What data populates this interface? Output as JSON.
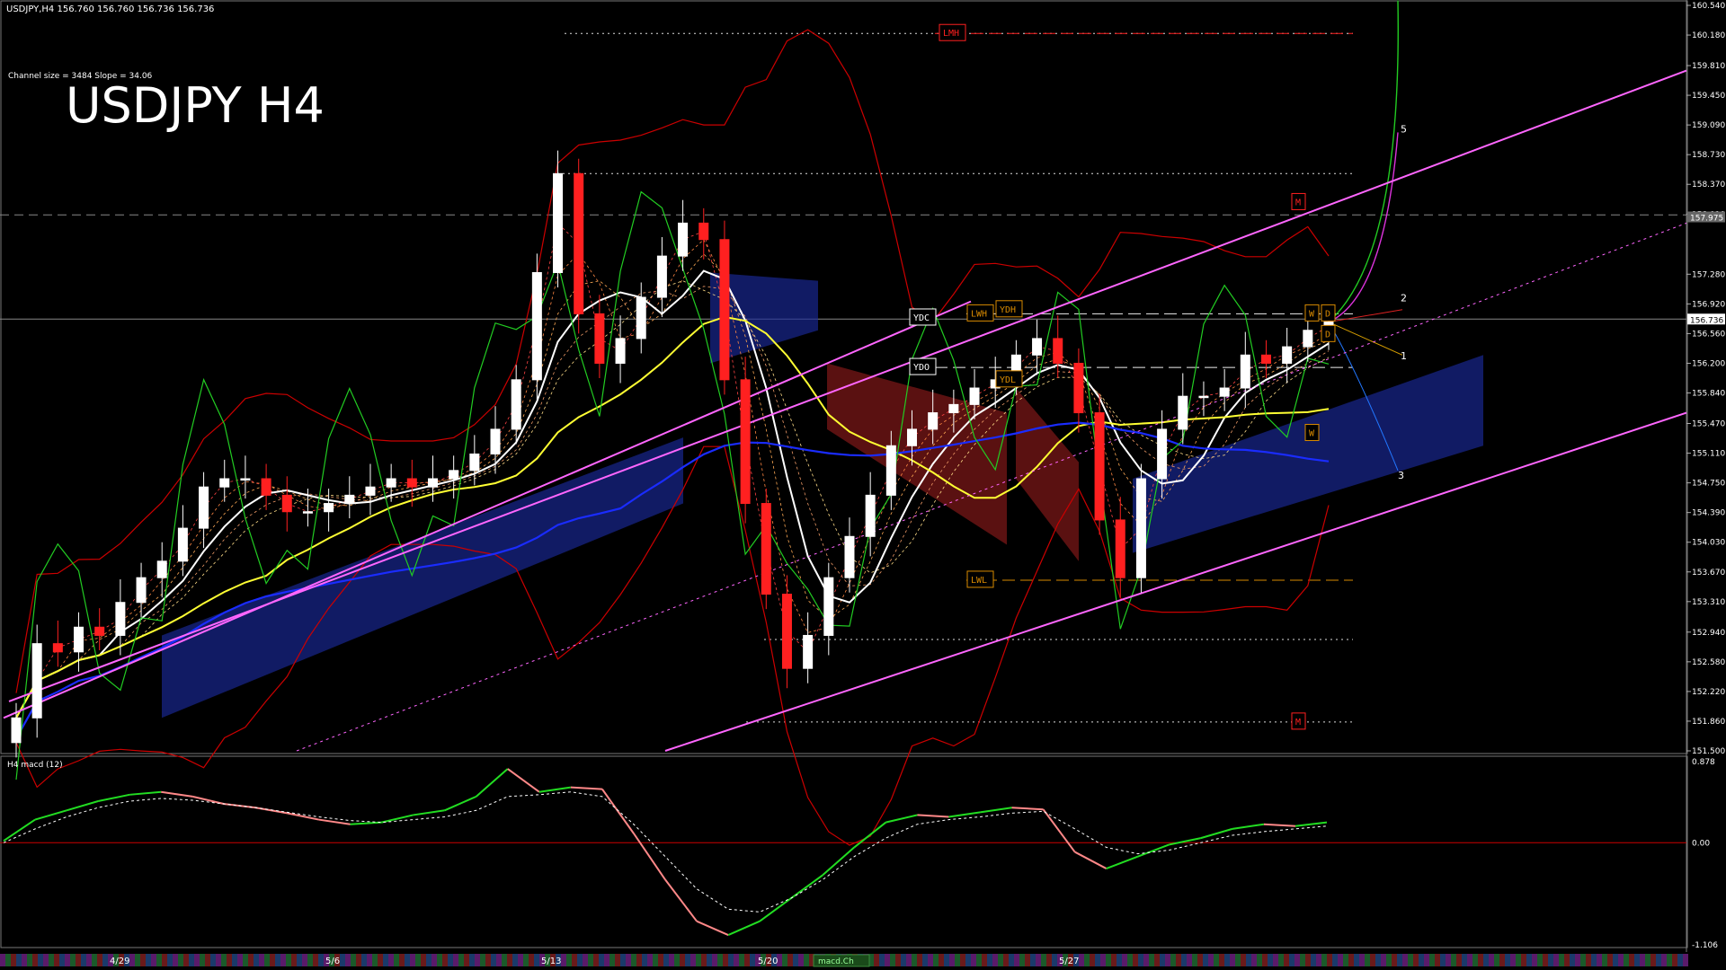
{
  "header": {
    "symbol_info": "USDJPY,H4  156.760 156.760 156.736 156.736",
    "channel_info": "Channel size = 3484 Slope = 34.06",
    "big_title": "USDJPY H4"
  },
  "colors": {
    "background": "#000000",
    "bull_candle": "#ffffff",
    "bear_candle": "#ff2020",
    "channel": "#ff66ff",
    "ma_white": "#ffffff",
    "ma_yellow": "#ffff33",
    "ma_blue": "#1a2cff",
    "bollinger": "#cc0000",
    "rsi_green": "#22cc22",
    "ichimoku_cloud": "#1a2a9a",
    "ichimoku_cloud_bear": "#8a1a1a",
    "label_orange": "#d98a00",
    "macd_main_up": "#22dd22",
    "macd_main_down": "#ff8888",
    "macd_signal": "#ffffff"
  },
  "chart_data": {
    "type": "candlestick",
    "symbol": "USDJPY",
    "timeframe": "H4",
    "price_axis": {
      "ylim": [
        151.5,
        160.54
      ],
      "ticks": [
        "160.540",
        "160.180",
        "159.810",
        "159.450",
        "159.090",
        "158.730",
        "158.370",
        "158.010",
        "157.280",
        "156.920",
        "156.560",
        "156.200",
        "155.840",
        "155.470",
        "155.110",
        "154.750",
        "154.390",
        "154.030",
        "153.670",
        "153.310",
        "152.940",
        "152.580",
        "152.220",
        "151.860",
        "151.500"
      ],
      "current_price": "156.736",
      "marked_price": "157.975"
    },
    "date_ticks": [
      "4/29",
      "5/6",
      "5/13",
      "5/20",
      "5/27"
    ],
    "levels": [
      {
        "label": "LMH",
        "price": 160.2
      },
      {
        "label": "M",
        "price": 158.15
      },
      {
        "label": "M",
        "price": 151.85
      },
      {
        "label": "YDC",
        "price": 156.75
      },
      {
        "label": "YDO",
        "price": 156.15
      },
      {
        "label": "YDH",
        "price": 156.85
      },
      {
        "label": "YDL",
        "price": 156.0
      },
      {
        "label": "LWH",
        "price": 156.8
      },
      {
        "label": "LWL",
        "price": 153.57
      },
      {
        "label": "W",
        "price": 156.8
      },
      {
        "label": "W",
        "price": 155.35
      },
      {
        "label": "D",
        "price": 156.8
      },
      {
        "label": "D",
        "price": 156.55
      }
    ],
    "projection_labels": [
      "5",
      "2",
      "1",
      "3"
    ],
    "candles_close": [
      151.9,
      152.8,
      152.7,
      153.0,
      152.9,
      153.3,
      153.6,
      153.8,
      154.2,
      154.7,
      154.8,
      154.8,
      154.6,
      154.4,
      154.4,
      154.5,
      154.6,
      154.7,
      154.8,
      154.7,
      154.8,
      154.9,
      155.1,
      155.4,
      156.0,
      157.3,
      158.5,
      156.8,
      156.2,
      156.5,
      157.0,
      157.5,
      157.9,
      157.7,
      156.0,
      154.5,
      153.4,
      152.5,
      152.9,
      153.6,
      154.1,
      154.6,
      155.2,
      155.4,
      155.6,
      155.7,
      155.9,
      156.0,
      156.3,
      156.5,
      156.2,
      155.6,
      154.3,
      153.6,
      154.8,
      155.4,
      155.8,
      155.8,
      155.9,
      156.3,
      156.2,
      156.4,
      156.6,
      156.7
    ],
    "macd": {
      "title": "H4 macd (12)",
      "ylim": [
        -1.106,
        0.878
      ],
      "ticks": [
        "0.878",
        "0.00",
        "-1.106"
      ],
      "main": [
        0.02,
        0.25,
        0.35,
        0.45,
        0.52,
        0.55,
        0.5,
        0.42,
        0.38,
        0.32,
        0.25,
        0.2,
        0.22,
        0.3,
        0.35,
        0.5,
        0.8,
        0.55,
        0.6,
        0.58,
        0.1,
        -0.4,
        -0.85,
        -1.0,
        -0.85,
        -0.6,
        -0.35,
        -0.05,
        0.22,
        0.3,
        0.28,
        0.33,
        0.38,
        0.36,
        -0.1,
        -0.28,
        -0.15,
        -0.02,
        0.05,
        0.15,
        0.2,
        0.18,
        0.22
      ],
      "signal": [
        0.0,
        0.15,
        0.28,
        0.38,
        0.45,
        0.48,
        0.46,
        0.42,
        0.38,
        0.33,
        0.28,
        0.24,
        0.22,
        0.25,
        0.28,
        0.35,
        0.5,
        0.52,
        0.55,
        0.5,
        0.2,
        -0.15,
        -0.5,
        -0.72,
        -0.75,
        -0.6,
        -0.4,
        -0.15,
        0.05,
        0.2,
        0.25,
        0.28,
        0.32,
        0.34,
        0.15,
        -0.05,
        -0.12,
        -0.08,
        0.0,
        0.08,
        0.12,
        0.15,
        0.18
      ]
    },
    "bottom_tab": "macd.Ch"
  }
}
